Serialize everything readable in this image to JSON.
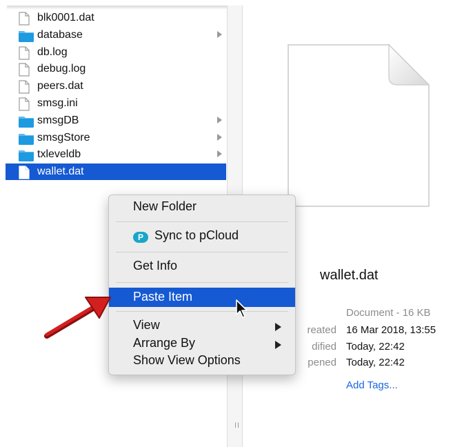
{
  "files": [
    {
      "name": "blk0001.dat",
      "kind": "file",
      "has_children": false,
      "selected": false
    },
    {
      "name": "database",
      "kind": "folder",
      "has_children": true,
      "selected": false
    },
    {
      "name": "db.log",
      "kind": "file",
      "has_children": false,
      "selected": false
    },
    {
      "name": "debug.log",
      "kind": "file",
      "has_children": false,
      "selected": false
    },
    {
      "name": "peers.dat",
      "kind": "file",
      "has_children": false,
      "selected": false
    },
    {
      "name": "smsg.ini",
      "kind": "file",
      "has_children": false,
      "selected": false
    },
    {
      "name": "smsgDB",
      "kind": "folder",
      "has_children": true,
      "selected": false
    },
    {
      "name": "smsgStore",
      "kind": "folder",
      "has_children": true,
      "selected": false
    },
    {
      "name": "txleveldb",
      "kind": "folder",
      "has_children": true,
      "selected": false
    },
    {
      "name": "wallet.dat",
      "kind": "file",
      "has_children": false,
      "selected": true
    }
  ],
  "context_menu": {
    "new_folder": "New Folder",
    "sync_pcloud": "Sync to pCloud",
    "pcloud_icon_letter": "P",
    "get_info": "Get Info",
    "paste_item": "Paste Item",
    "view": "View",
    "arrange_by": "Arrange By",
    "show_view_options": "Show View Options"
  },
  "preview": {
    "name": "wallet.dat",
    "kind_size": "Document - 16 KB",
    "created_label": "reated",
    "created_value": "16 Mar 2018, 13:55",
    "modified_label": "dified",
    "modified_value": "Today, 22:42",
    "opened_label": "pened",
    "opened_value": "Today, 22:42",
    "add_tags": "Add Tags..."
  },
  "column_resize_glyph": "II",
  "colors": {
    "selection": "#1559d3",
    "folder": "#1e9ae0",
    "link": "#1a66e0",
    "annotation_arrow": "#d41f1f",
    "pcloud": "#19a6c9"
  }
}
